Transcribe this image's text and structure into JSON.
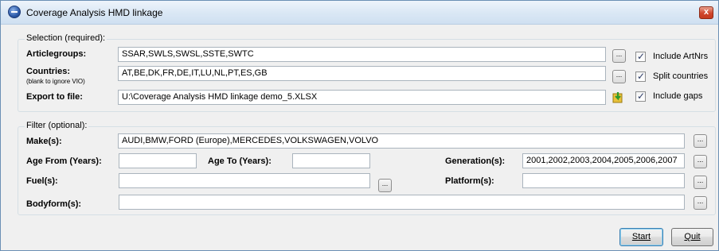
{
  "window": {
    "title": "Coverage Analysis HMD linkage",
    "close_label": "x"
  },
  "selection": {
    "group_title": "Selection (required):",
    "articlegroups": {
      "label": "Articlegroups:",
      "value": "SSAR,SWLS,SWSL,SSTE,SWTC",
      "browse_label": "...",
      "checkbox_label": "Include ArtNrs",
      "checked": true
    },
    "countries": {
      "label": "Countries:",
      "sublabel": "(blank to ignore VIO)",
      "value": "AT,BE,DK,FR,DE,IT,LU,NL,PT,ES,GB",
      "browse_label": "...",
      "checkbox_label": "Split countries",
      "checked": true
    },
    "export": {
      "label": "Export to file:",
      "value": "U:\\Coverage Analysis HMD linkage demo_5.XLSX",
      "icon": "excel-export-icon",
      "checkbox_label": "Include gaps",
      "checked": true
    }
  },
  "filter": {
    "group_title": "Filter (optional):",
    "makes": {
      "label": "Make(s):",
      "value": "AUDI,BMW,FORD (Europe),MERCEDES,VOLKSWAGEN,VOLVO",
      "browse_label": "..."
    },
    "age_from": {
      "label": "Age From (Years):",
      "value": ""
    },
    "age_to": {
      "label": "Age To (Years):",
      "value": ""
    },
    "generations": {
      "label": "Generation(s):",
      "value": "2001,2002,2003,2004,2005,2006,2007",
      "browse_label": "..."
    },
    "fuels": {
      "label": "Fuel(s):",
      "value": "",
      "browse_label": "..."
    },
    "platforms": {
      "label": "Platform(s):",
      "value": "",
      "browse_label": "..."
    },
    "bodyforms": {
      "label": "Bodyform(s):",
      "value": "",
      "browse_label": "..."
    }
  },
  "buttons": {
    "start": "Start",
    "quit": "Quit"
  }
}
